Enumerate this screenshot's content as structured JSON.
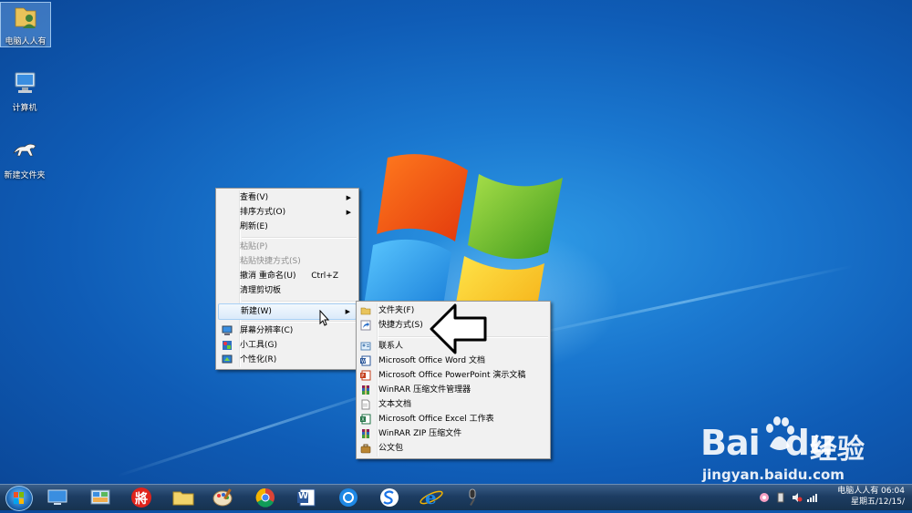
{
  "desktop": {
    "icons": [
      {
        "label": "电脑人人有"
      },
      {
        "label": "计算机"
      },
      {
        "label": "新建文件夹"
      }
    ]
  },
  "context_menu": {
    "items": [
      {
        "label": "查看(V)"
      },
      {
        "label": "排序方式(O)"
      },
      {
        "label": "刷新(E)"
      },
      {
        "label": "粘贴(P)"
      },
      {
        "label": "粘贴快捷方式(S)"
      },
      {
        "label": "撤消 重命名(U)",
        "shortcut": "Ctrl+Z"
      },
      {
        "label": "清理剪切板"
      },
      {
        "label": "新建(W)"
      },
      {
        "label": "屏幕分辨率(C)"
      },
      {
        "label": "小工具(G)"
      },
      {
        "label": "个性化(R)"
      }
    ]
  },
  "new_submenu": {
    "items": [
      {
        "label": "文件夹(F)"
      },
      {
        "label": "快捷方式(S)"
      },
      {
        "label": "联系人"
      },
      {
        "label": "Microsoft Office Word 文档"
      },
      {
        "label": "Microsoft Office PowerPoint 演示文稿"
      },
      {
        "label": "WinRAR 压缩文件管理器"
      },
      {
        "label": "文本文档"
      },
      {
        "label": "Microsoft Office Excel 工作表"
      },
      {
        "label": "WinRAR ZIP 压缩文件"
      },
      {
        "label": "公文包"
      }
    ]
  },
  "taskbar": {
    "pinned": [
      {
        "icon": "desktop-icon"
      },
      {
        "icon": "control-panel-icon"
      },
      {
        "icon": "chess-icon",
        "text": "將"
      },
      {
        "icon": "folder-icon"
      },
      {
        "icon": "paint-icon"
      },
      {
        "icon": "chrome-icon"
      },
      {
        "icon": "word-icon",
        "text": "W"
      },
      {
        "icon": "browser-icon"
      },
      {
        "icon": "sogou-icon"
      },
      {
        "icon": "ie-icon",
        "text": "e"
      },
      {
        "icon": "microphone-icon"
      }
    ],
    "clock": {
      "line1": "电脑人人有 06:04",
      "line2": "星期五/12/15/"
    }
  },
  "watermark": {
    "word": "Bai",
    "word2": "du",
    "cn": "经验",
    "url": "jingyan.baidu.com"
  }
}
